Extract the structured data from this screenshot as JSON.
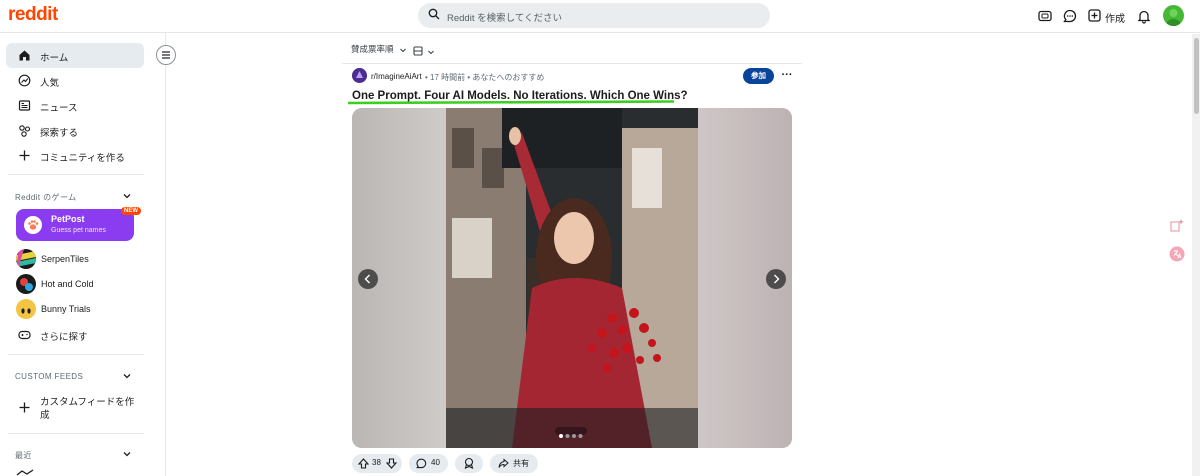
{
  "header": {
    "logo": "reddit",
    "search_placeholder": "Reddit を検索してください",
    "create_label": "作成"
  },
  "sidebar": {
    "nav": [
      {
        "label": "ホーム",
        "icon": "home-icon",
        "active": true
      },
      {
        "label": "人気",
        "icon": "popular-icon"
      },
      {
        "label": "ニュース",
        "icon": "news-icon"
      },
      {
        "label": "探索する",
        "icon": "explore-icon"
      },
      {
        "label": "コミュニティを作る",
        "icon": "plus-icon"
      }
    ],
    "games_heading": "Reddit のゲーム",
    "petpost": {
      "title": "PetPost",
      "subtitle": "Guess pet names",
      "badge": "NEW"
    },
    "games": [
      {
        "label": "SerpenTiles"
      },
      {
        "label": "Hot and Cold"
      },
      {
        "label": "Bunny Trials"
      }
    ],
    "more_games": "さらに探す",
    "custom_feeds_heading": "CUSTOM FEEDS",
    "custom_feed_create": "カスタムフィードを作成",
    "recent_heading": "最近"
  },
  "feed": {
    "sort_label": "賛成票率順",
    "post": {
      "subreddit": "r/ImagineAiArt",
      "time": "• 17 時間前 • あなたへのおすすめ",
      "join_label": "参加",
      "title": "One Prompt. Four AI Models. No Iterations. Which One Wins?",
      "votes": "38",
      "comments": "40",
      "share_label": "共有"
    }
  },
  "colors": {
    "brand": "#ff4500",
    "join_button": "#0a449b",
    "petpost_bg": "#8b3cf0",
    "highlight_underline": "#3ccf22"
  }
}
